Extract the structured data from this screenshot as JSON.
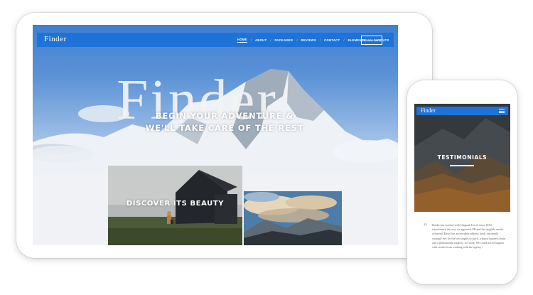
{
  "tablet": {
    "nav": {
      "logo": "Finder",
      "items": [
        "HOME",
        "ABOUT",
        "PACKAGES",
        "REVIEWS",
        "CONTACT",
        "ELEMENTS",
        "LAYOUTS"
      ],
      "download_label": "DOWNLOAD"
    },
    "hero": {
      "big_title": "Finder",
      "tagline_line1": "BEGIN YOUR ADVENTURE &",
      "tagline_line2": "WE'LL TAKE CARE OF THE REST"
    },
    "card": {
      "caption": "DISCOVER ITS BEAUTY"
    }
  },
  "phone": {
    "nav": {
      "logo": "Finder"
    },
    "section_title": "TESTIMONIALS",
    "quote_mark": "“",
    "testimonial_text": "Finder has worked with Original Travel since 2010, transformed the way we approach PR and the tangible results achieved. Daisy has an enviable address book, uncannily strategic eye for the best angles to pitch, a sharp business brain and a phenomenal capacity for work. We could not be happier with results from working with the agency!"
  },
  "colors": {
    "nav_blue": "#1e73d8",
    "sky_top": "#3f7fd0",
    "device_frame": "#ffffff"
  }
}
